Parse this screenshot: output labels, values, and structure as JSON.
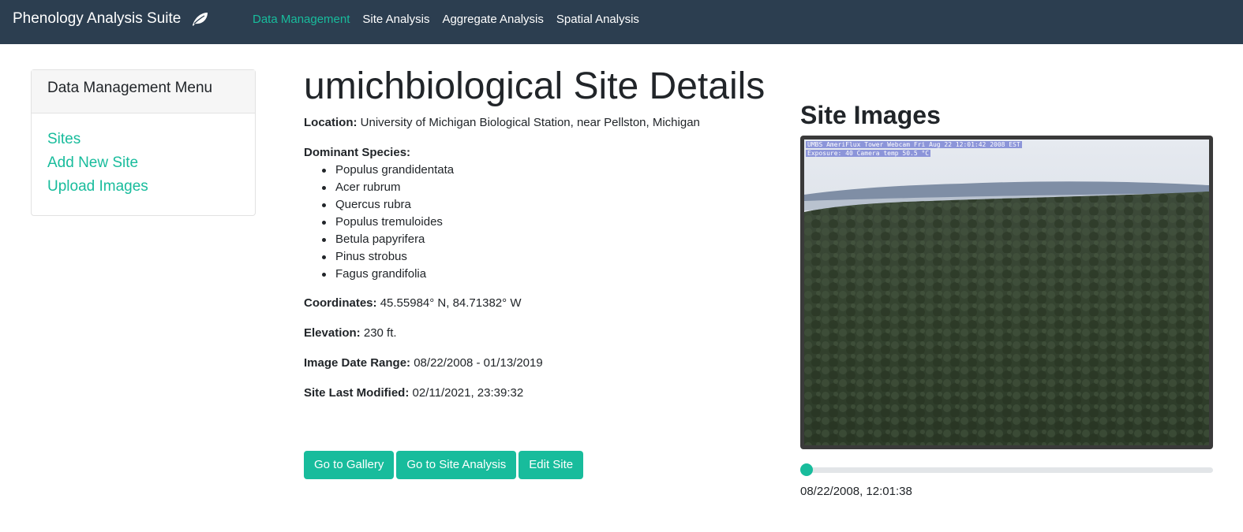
{
  "navbar": {
    "brand": "Phenology Analysis Suite",
    "brand_icon": "leaf-icon",
    "links": [
      {
        "label": "Data Management",
        "active": true
      },
      {
        "label": "Site Analysis",
        "active": false
      },
      {
        "label": "Aggregate Analysis",
        "active": false
      },
      {
        "label": "Spatial Analysis",
        "active": false
      }
    ]
  },
  "sidebar": {
    "header": "Data Management Menu",
    "items": [
      {
        "label": "Sites"
      },
      {
        "label": "Add New Site"
      },
      {
        "label": "Upload Images"
      }
    ]
  },
  "site": {
    "title": "umichbiological Site Details",
    "location_label": "Location:",
    "location": "University of Michigan Biological Station, near Pellston, Michigan",
    "species_label": "Dominant Species:",
    "species": [
      "Populus grandidentata",
      "Acer rubrum",
      "Quercus rubra",
      "Populus tremuloides",
      "Betula papyrifera",
      "Pinus strobus",
      "Fagus grandifolia"
    ],
    "coordinates_label": "Coordinates:",
    "coordinates": "45.55984° N, 84.71382° W",
    "elevation_label": "Elevation:",
    "elevation": "230 ft.",
    "date_range_label": "Image Date Range:",
    "date_range": "08/22/2008 - 01/13/2019",
    "modified_label": "Site Last Modified:",
    "modified": "02/11/2021, 23:39:32"
  },
  "buttons": {
    "gallery": "Go to Gallery",
    "site_analysis": "Go to Site Analysis",
    "edit": "Edit Site"
  },
  "images": {
    "title": "Site Images",
    "overlay_line1": "UMBS AmeriFlux Tower Webcam Fri Aug 22 12:01:42 2008 EST",
    "overlay_line2": "Exposure: 40 Camera temp 50.5 °C",
    "slider_position": 0,
    "timestamp": "08/22/2008, 12:01:38"
  },
  "colors": {
    "navbar_bg": "#2c3e50",
    "accent": "#18bc9c"
  }
}
